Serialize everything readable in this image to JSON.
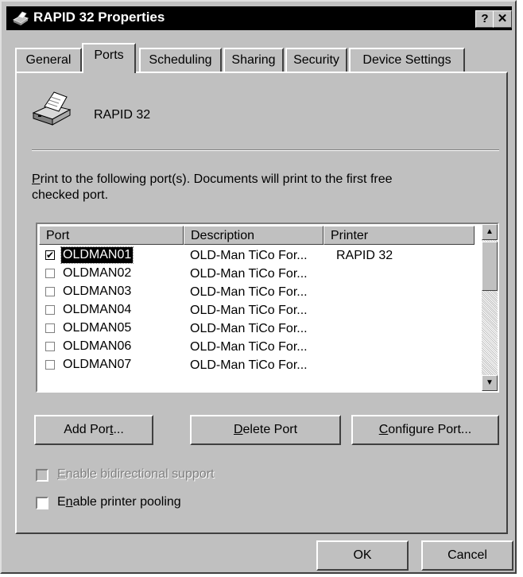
{
  "window": {
    "title": "RAPID 32 Properties",
    "help_button": "?",
    "close_button": "✕"
  },
  "tabs": [
    {
      "label": "General"
    },
    {
      "label": "Ports"
    },
    {
      "label": "Scheduling"
    },
    {
      "label": "Sharing"
    },
    {
      "label": "Security"
    },
    {
      "label": "Device Settings"
    }
  ],
  "printer_name": "RAPID 32",
  "instructions": {
    "line1_prefix": "P",
    "line1_rest": "rint to the following port(s).  Documents will print to the first free",
    "line2": "checked port."
  },
  "port_list": {
    "headers": [
      "Port",
      "Description",
      "Printer"
    ],
    "rows": [
      {
        "port": "OLDMAN01",
        "description": "OLD-Man TiCo For...",
        "printer": "RAPID 32",
        "checked": "✔"
      },
      {
        "port": "OLDMAN02",
        "description": "OLD-Man TiCo For...",
        "printer": "",
        "checked": ""
      },
      {
        "port": "OLDMAN03",
        "description": "OLD-Man TiCo For...",
        "printer": "",
        "checked": ""
      },
      {
        "port": "OLDMAN04",
        "description": "OLD-Man TiCo For...",
        "printer": "",
        "checked": ""
      },
      {
        "port": "OLDMAN05",
        "description": "OLD-Man TiCo For...",
        "printer": "",
        "checked": ""
      },
      {
        "port": "OLDMAN06",
        "description": "OLD-Man TiCo For...",
        "printer": "",
        "checked": ""
      },
      {
        "port": "OLDMAN07",
        "description": "OLD-Man TiCo For...",
        "printer": "",
        "checked": ""
      }
    ],
    "scroll_up": "▲",
    "scroll_down": "▼"
  },
  "port_buttons": {
    "add_prefix": "Add Por",
    "add_mnemonic": "t",
    "add_suffix": "...",
    "delete_mnemonic": "D",
    "delete_rest": "elete Port",
    "configure_mnemonic": "C",
    "configure_rest": "onfigure Port..."
  },
  "options": {
    "bidi_mnemonic": "E",
    "bidi_rest": "nable bidirectional support",
    "pool_prefix": "E",
    "pool_mnemonic": "n",
    "pool_rest": "able printer pooling"
  },
  "dialog_buttons": {
    "ok": "OK",
    "cancel": "Cancel"
  }
}
